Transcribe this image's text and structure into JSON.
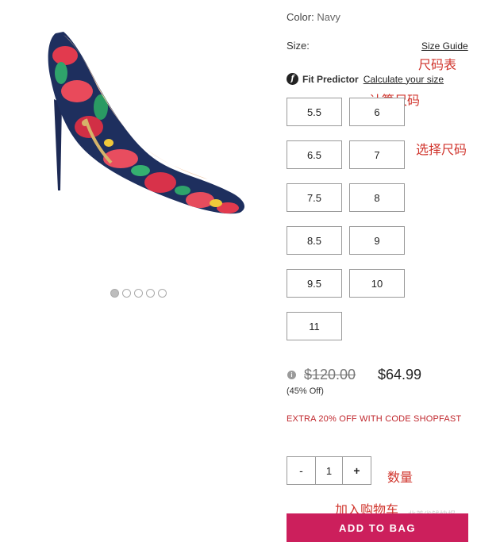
{
  "product": {
    "color_label": "Color:",
    "color_value": "Navy",
    "size_label": "Size:",
    "size_guide": "Size Guide",
    "fit_icon_text": "f",
    "fit_predictor": "Fit Predictor",
    "calculate_size": "Calculate your size",
    "sizes": [
      "5.5",
      "6",
      "6.5",
      "7",
      "7.5",
      "8",
      "8.5",
      "9",
      "9.5",
      "10",
      "11"
    ],
    "gallery_dots": 5,
    "gallery_active_index": 0
  },
  "pricing": {
    "info_icon_text": "i",
    "original_price": "$120.00",
    "sale_price": "$64.99",
    "discount": "(45% Off)",
    "promo": "EXTRA 20% OFF WITH CODE SHOPFAST"
  },
  "quantity": {
    "minus": "-",
    "value": "1",
    "plus": "+"
  },
  "cart": {
    "add_to_bag": "ADD TO BAG"
  },
  "annotations": {
    "size_chart": "尺码表",
    "calculate_size": "计算尺码",
    "choose_size": "选择尺码",
    "quantity": "数量",
    "add_to_cart": "加入购物车"
  },
  "watermark": "北美省钱快报",
  "colors": {
    "accent": "#cc1f5c",
    "promo": "#c0272d",
    "annotation": "#d0342c"
  }
}
